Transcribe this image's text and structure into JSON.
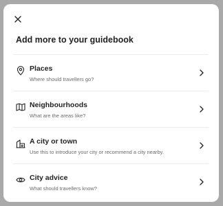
{
  "modal": {
    "title": "Add more to your guidebook",
    "close_icon": "close-icon"
  },
  "items": [
    {
      "label": "Places",
      "description": "Where should travellers go?",
      "icon": "map-pin-icon"
    },
    {
      "label": "Neighbourhoods",
      "description": "What are the areas like?",
      "icon": "map-icon"
    },
    {
      "label": "A city or town",
      "description": "Use this to introduce your city or recommend a city nearby.",
      "icon": "city-icon"
    },
    {
      "label": "City advice",
      "description": "What should travellers know?",
      "icon": "eye-icon"
    }
  ],
  "colors": {
    "overlay": "#a9a9a9",
    "surface": "#ffffff",
    "text_primary": "#222222",
    "text_secondary": "#6a6a6a",
    "divider": "#ececec"
  }
}
